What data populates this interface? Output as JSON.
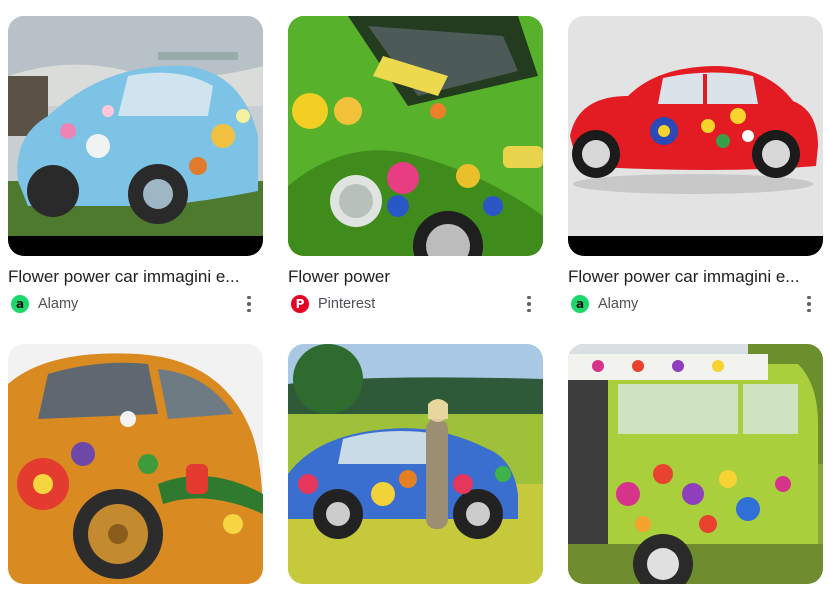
{
  "results": [
    {
      "title": "Flower power car immagini e...",
      "source": "Alamy",
      "source_icon": "alamy-icon",
      "source_icon_color": "#1ad86b",
      "image": "light-blue-flower-beetle"
    },
    {
      "title": "Flower power",
      "source": "Pinterest",
      "source_icon": "pinterest-icon",
      "source_icon_color": "#e60023",
      "image": "green-flower-beetle"
    },
    {
      "title": "Flower power car immagini e...",
      "source": "Alamy",
      "source_icon": "alamy-icon",
      "source_icon_color": "#1ad86b",
      "image": "red-flower-beetle"
    },
    {
      "image": "orange-flower-beetle"
    },
    {
      "image": "woman-with-rainbow-beetle-in-field"
    },
    {
      "image": "lime-flower-vw-bus"
    }
  ],
  "icons": {
    "alamy_glyph": "a",
    "pinterest_glyph": "P"
  }
}
